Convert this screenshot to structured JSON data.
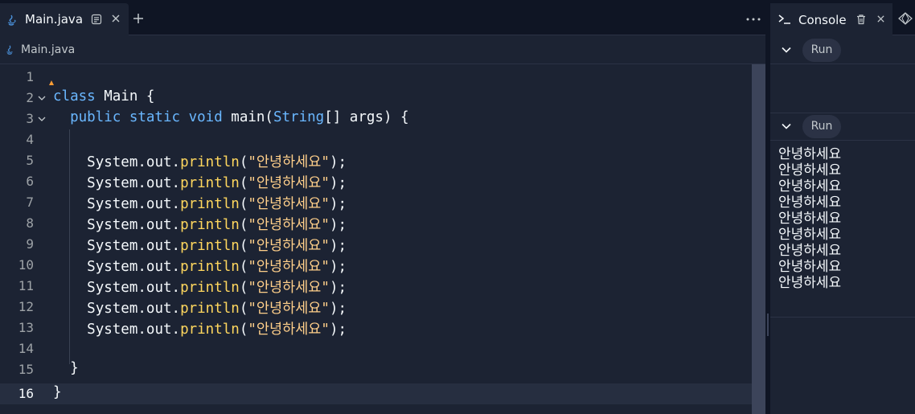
{
  "editor": {
    "tab": {
      "label": "Main.java"
    },
    "breadcrumb": {
      "file": "Main.java"
    },
    "lines": [
      {
        "num": "1"
      },
      {
        "num": "2"
      },
      {
        "num": "3"
      },
      {
        "num": "4"
      },
      {
        "num": "5"
      },
      {
        "num": "6"
      },
      {
        "num": "7"
      },
      {
        "num": "8"
      },
      {
        "num": "9"
      },
      {
        "num": "10"
      },
      {
        "num": "11"
      },
      {
        "num": "12"
      },
      {
        "num": "13"
      },
      {
        "num": "14"
      },
      {
        "num": "15"
      },
      {
        "num": "16"
      }
    ],
    "code": {
      "class_kw": "class",
      "class_name": "Main {",
      "public_kw": "public static void",
      "main_sig": "main(",
      "string_type": "String",
      "args": "[] args) {",
      "print_prefix": "System.out.",
      "print_fn": "println",
      "print_str": "\"안녕하세요\"",
      "print_end": ");",
      "close_inner": "}",
      "close_outer": "}"
    }
  },
  "console": {
    "tab_label": "Console",
    "run_label_1": "Run",
    "run_label_2": "Run",
    "output": "안녕하세요\n안녕하세요\n안녕하세요\n안녕하세요\n안녕하세요\n안녕하세요\n안녕하세요\n안녕하세요\n안녕하세요"
  }
}
